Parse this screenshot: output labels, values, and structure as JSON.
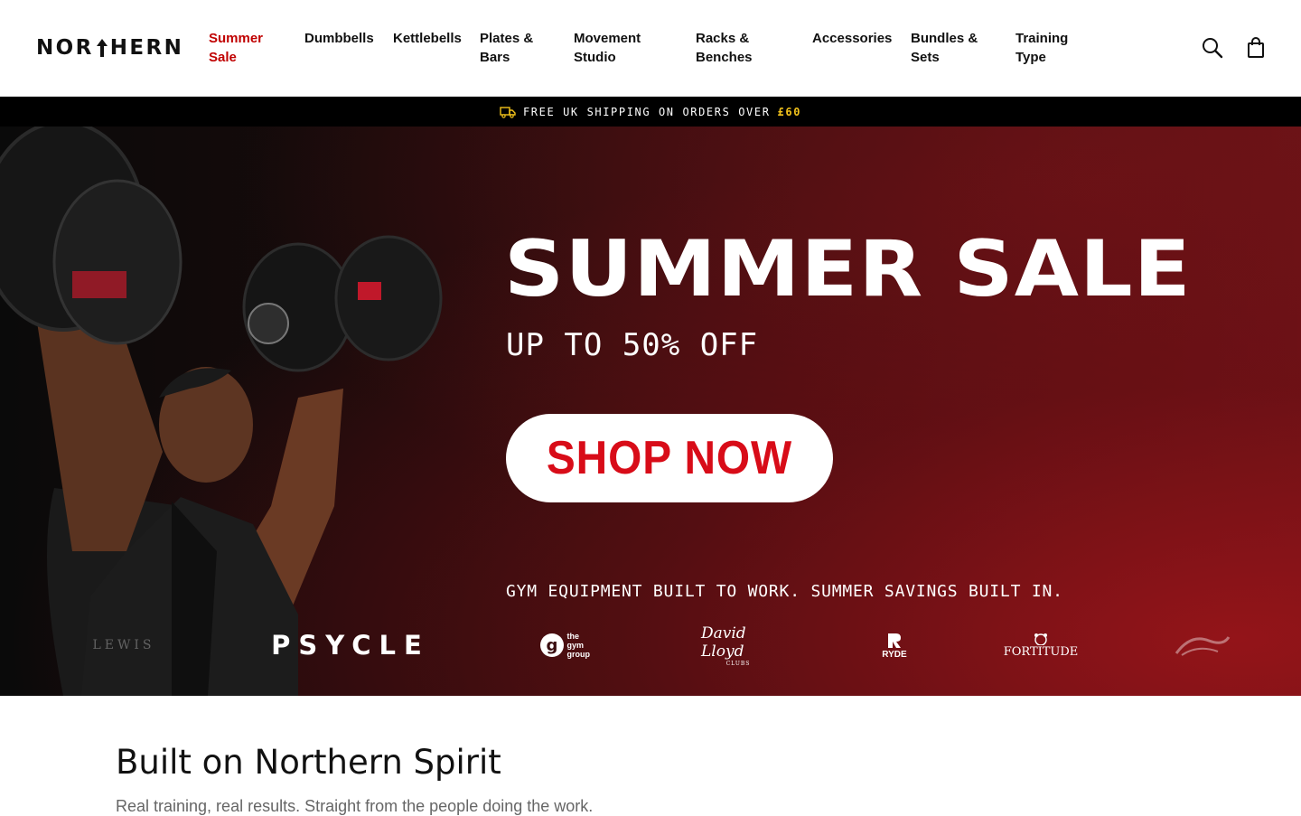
{
  "brand": {
    "logo_text_left": "NOR",
    "logo_text_right": "HERN"
  },
  "nav": {
    "items": [
      {
        "line1": "Summer",
        "line2": "Sale"
      },
      {
        "line1": "Dumbbells",
        "line2": ""
      },
      {
        "line1": "Kettlebells",
        "line2": ""
      },
      {
        "line1": "Plates &",
        "line2": "Bars"
      },
      {
        "line1": "Movement",
        "line2": "Studio"
      },
      {
        "line1": "Racks &",
        "line2": "Benches"
      },
      {
        "line1": "Accessories",
        "line2": ""
      },
      {
        "line1": "Bundles &",
        "line2": "Sets"
      },
      {
        "line1": "Training",
        "line2": "Type"
      }
    ],
    "sale_color": "#c00000"
  },
  "icons": {
    "search": "search-icon",
    "cart": "shopping-bag-icon",
    "truck": "truck-icon"
  },
  "shipping": {
    "text": "FREE UK SHIPPING ON ORDERS OVER",
    "amount": "£60",
    "amount_color": "#f2c21b"
  },
  "hero": {
    "title": "SUMMER SALE",
    "subtitle": "UP TO 50% OFF",
    "cta": "SHOP NOW",
    "cta_color": "#d80c18",
    "tagline": "GYM EQUIPMENT BUILT TO WORK. SUMMER SAVINGS BUILT IN.",
    "partners": {
      "lewis": "LEWIS",
      "psycle": "PSYCLE",
      "gym_group": "the gym group",
      "david_lloyd": "David Lloyd",
      "david_lloyd_sub": "CLUBS",
      "ryde": "RYDE",
      "fortitude": "FORTITUDE"
    }
  },
  "section": {
    "title": "Built on Northern Spirit",
    "subtitle": "Real training, real results. Straight from the people doing the work."
  }
}
